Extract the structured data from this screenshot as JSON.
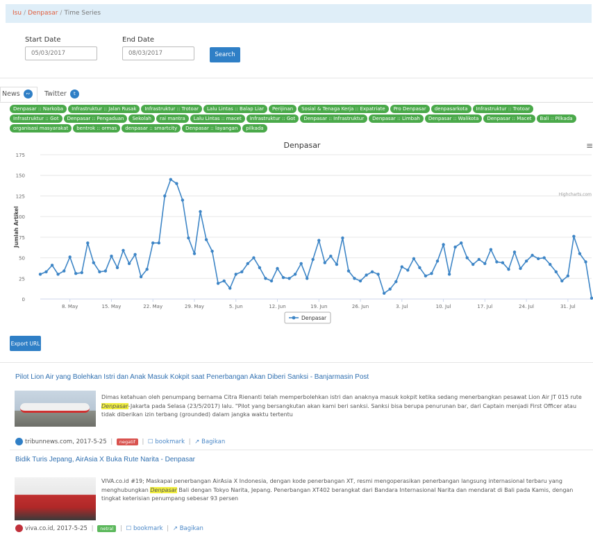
{
  "breadcrumb": {
    "root": "Isu",
    "parent": "Denpasar",
    "current": "Time Series",
    "separator": "/"
  },
  "filter": {
    "start_label": "Start Date",
    "start_value": "05/03/2017",
    "end_label": "End Date",
    "end_value": "08/03/2017",
    "search_label": "Search"
  },
  "tabs": [
    {
      "label": "News",
      "icon": "rss-icon",
      "active": true
    },
    {
      "label": "Twitter",
      "icon": "twitter-icon",
      "active": false
    }
  ],
  "tags": [
    "Denpasar :: Narkoba",
    "Infrastruktur :: Jalan Rusak",
    "Infrastruktur :: Trotoar",
    "Lalu Lintas :: Balap Liar",
    "Perijinan",
    "Sosial & Tenaga Kerja :: Expatriate",
    "Pro Denpasar",
    "denpasarkota",
    "Infrastruktur :: Trotoar",
    "Infrastruktur :: Got",
    "Denpasar :: Pengaduan",
    "Sekolah",
    "rai mantra",
    "Lalu Lintas :: macet",
    "Infrastruktur :: Got",
    "Denpasar :: Infrastruktur",
    "Denpasar :: Limbah",
    "Denpasar :: Walikota",
    "Denpasar :: Macet",
    "Bali :: Pilkada",
    "organisasi masyarakat",
    "bentrok :: ormas",
    "denpasar :: smartcity",
    "Denpasar :: layangan",
    "pilkada"
  ],
  "colors": {
    "accent": "#2f7fc6",
    "tag": "#4aa94a",
    "series": "#3d85c6",
    "negative": "#d9534f",
    "neutral": "#5cb85c"
  },
  "chart_data": {
    "type": "line",
    "title": "Denpasar",
    "ylabel": "Jumlah Artikel",
    "xlabel": "",
    "ylim": [
      0,
      175
    ],
    "yticks": [
      0,
      25,
      50,
      75,
      100,
      125,
      150,
      175
    ],
    "xtick_labels": [
      "8. May",
      "15. May",
      "22. May",
      "29. May",
      "5. Jun",
      "12. Jun",
      "19. Jun",
      "26. Jun",
      "3. Jul",
      "10. Jul",
      "17. Jul",
      "24. Jul",
      "31. Jul"
    ],
    "x_start": "3. May",
    "grid": true,
    "legend": "bottom-center",
    "series": [
      {
        "name": "Denpasar",
        "values": [
          30,
          33,
          41,
          30,
          34,
          51,
          31,
          32,
          68,
          44,
          33,
          34,
          52,
          38,
          59,
          43,
          54,
          27,
          36,
          68,
          68,
          125,
          145,
          140,
          120,
          74,
          55,
          106,
          72,
          58,
          19,
          22,
          13,
          30,
          33,
          43,
          50,
          38,
          25,
          22,
          37,
          26,
          25,
          30,
          43,
          25,
          48,
          71,
          44,
          52,
          42,
          74,
          34,
          25,
          22,
          29,
          33,
          30,
          7,
          12,
          21,
          39,
          35,
          49,
          38,
          28,
          31,
          46,
          66,
          30,
          63,
          68,
          50,
          42,
          48,
          43,
          60,
          45,
          44,
          36,
          57,
          37,
          46,
          53,
          49,
          50,
          42,
          33,
          22,
          28,
          76,
          55,
          45,
          1
        ]
      }
    ]
  },
  "credit": "Highcharts.com",
  "export_label": "Export URL",
  "articles": [
    {
      "title": "Pilot Lion Air yang Bolehkan Istri dan Anak Masuk Kokpit saat Penerbangan Akan Diberi Sanksi - Banjarmasin Post",
      "snippet_before": "Dimas ketahuan oleh penumpang bernama Citra Rienanti telah memperbolehkan istri dan anaknya masuk kokpit ketika sedang menerbangkan pesawat Lion Air JT 015 rute ",
      "highlight": "Denpasar",
      "snippet_after": "-Jakarta pada Selasa (23/5/2017) lalu. \"Pilot yang bersangkutan akan kami beri sanksi. Sanksi bisa berupa penurunan bar, dari Captain menjadi First Officer atau tidak diberikan izin terbang (grounded) dalam jangka waktu tertentu",
      "source": "tribunnews.com, 2017-5-25",
      "sentiment": "negatif",
      "bookmark": "bookmark",
      "share": "Bagikan"
    },
    {
      "title": "Bidik Turis Jepang, AirAsia X Buka Rute Narita - Denpasar",
      "snippet_before": "VIVA.co.id #19; Maskapai penerbangan AirAsia X Indonesia, dengan kode penerbangan XT, resmi mengoperasikan penerbangan langsung internasional terbaru yang menghubungkan ",
      "highlight": "Denpasar",
      "snippet_after": " Bali dengan Tokyo Narita, Jepang.   Penerbangan XT402 berangkat dari Bandara Internasional Narita dan mendarat di Bali pada Kamis, dengan tingkat keterisian penumpang sebesar 93 persen",
      "source": "viva.co.id, 2017-5-25",
      "sentiment": "netral",
      "bookmark": "bookmark",
      "share": "Bagikan"
    }
  ]
}
